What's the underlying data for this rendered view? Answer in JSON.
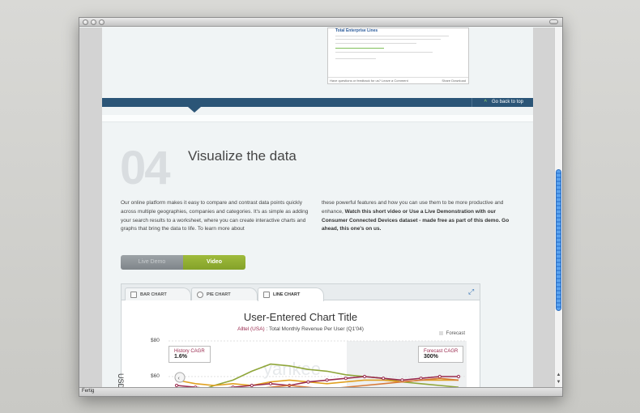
{
  "window": {
    "status": "Fertig"
  },
  "thumbnail": {
    "title": "Total Enterprise Lines",
    "footer_left": "Have questions or feedback for us? Leave a Comment",
    "footer_right": "Share  Download"
  },
  "banner": {
    "go_top": "Go back to top"
  },
  "section": {
    "number": "04",
    "title": "Visualize the data",
    "left_text": "Our online platform makes it easy to compare and contrast data points quickly across multiple geographies, companies and categories. It's as simple as adding your search results to a worksheet, where you can create interactive charts and graphs that bring the data to life. To learn more about",
    "right_text_plain": "these powerful features and how you can use them to be more productive and enhance,",
    "right_text_bold": "Watch this short video or Use a Live Demonstration with our Consumer Connected Devices dataset - made free as part of this demo. Go ahead, this one's on us."
  },
  "toggle": {
    "live": "Live Demo",
    "video": "Video"
  },
  "tabs": [
    {
      "label": "BAR CHART",
      "icon": "bar-chart-icon"
    },
    {
      "label": "PIE CHART",
      "icon": "pie-chart-icon"
    },
    {
      "label": "LINE CHART",
      "icon": "line-chart-icon"
    }
  ],
  "chart": {
    "title": "User-Entered Chart Title",
    "company": "Alltel (USA)",
    "subtitle_rest": " : Total Monthly Revenue Per User (Q1'04)",
    "legend_forecast": "Forecast",
    "ylabel": "USD in Mil",
    "y80": "$80",
    "y60": "$60",
    "watermark": "yankee",
    "history_label": "History CAGR",
    "history_value": "1.6%",
    "forecast_label": "Forecast CAGR",
    "forecast_value": "300%"
  },
  "chart_data": {
    "type": "line",
    "title": "User-Entered Chart Title",
    "ylabel": "USD in Mil",
    "yticks": [
      "$80",
      "$60"
    ],
    "series": [
      {
        "values": [
          52,
          51,
          55,
          58,
          63,
          67,
          66,
          64,
          63,
          61,
          60,
          59,
          57,
          56,
          55,
          54
        ]
      },
      {
        "values": [
          58,
          56,
          55,
          56,
          55,
          57,
          58,
          57,
          56,
          57,
          58,
          58,
          57,
          58,
          58,
          58
        ]
      },
      {
        "values": [
          55,
          54,
          53,
          54,
          55,
          56,
          55,
          57,
          58,
          59,
          60,
          59,
          58,
          59,
          60,
          60
        ]
      },
      {
        "values": [
          53,
          52,
          51,
          52,
          53,
          54,
          55,
          54,
          53,
          54,
          55,
          56,
          57,
          58,
          59,
          58
        ]
      }
    ],
    "colors": [
      "#8fa63a",
      "#e0a020",
      "#9a2b4f",
      "#d77a3a"
    ]
  }
}
